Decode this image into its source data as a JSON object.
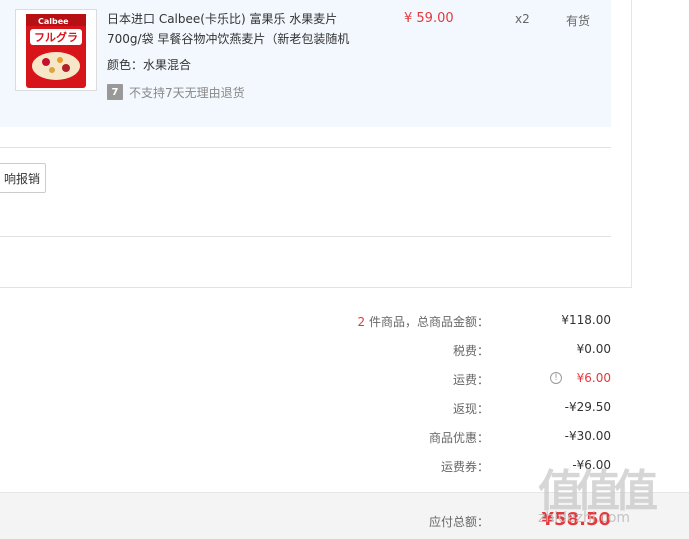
{
  "product": {
    "title": "日本进口 Calbee(卡乐比) 富果乐 水果麦片700g/袋 早餐谷物冲饮燕麦片（新老包装随机",
    "attr_label": "颜色：水果混合",
    "no_return_icon": "7",
    "no_return_text": "不支持7天无理由退货",
    "price": "¥ 59.00",
    "qty": "x2",
    "stock": "有货",
    "thumbnail_icon": "cereal-package-icon"
  },
  "invoice": {
    "button_label": "响报销"
  },
  "summary": {
    "items": [
      {
        "count": "2",
        "label": "件商品，总商品金额：",
        "value": "¥118.00"
      },
      {
        "label": "税费：",
        "value": "¥0.00"
      },
      {
        "label": "运费：",
        "value": "¥6.00",
        "accent": true,
        "icon": "info-icon"
      },
      {
        "label": "返现：",
        "value": "-¥29.50"
      },
      {
        "label": "商品优惠：",
        "value": "-¥30.00"
      },
      {
        "label": "运费券：",
        "value": "-¥6.00"
      }
    ],
    "total_label": "应付总额：",
    "total_value": "¥58.50"
  },
  "watermark": {
    "glyphs": "值值值",
    "url": "zhidezhi.com"
  },
  "colors": {
    "accent": "#e4393c",
    "panel": "#f3f8fe"
  }
}
